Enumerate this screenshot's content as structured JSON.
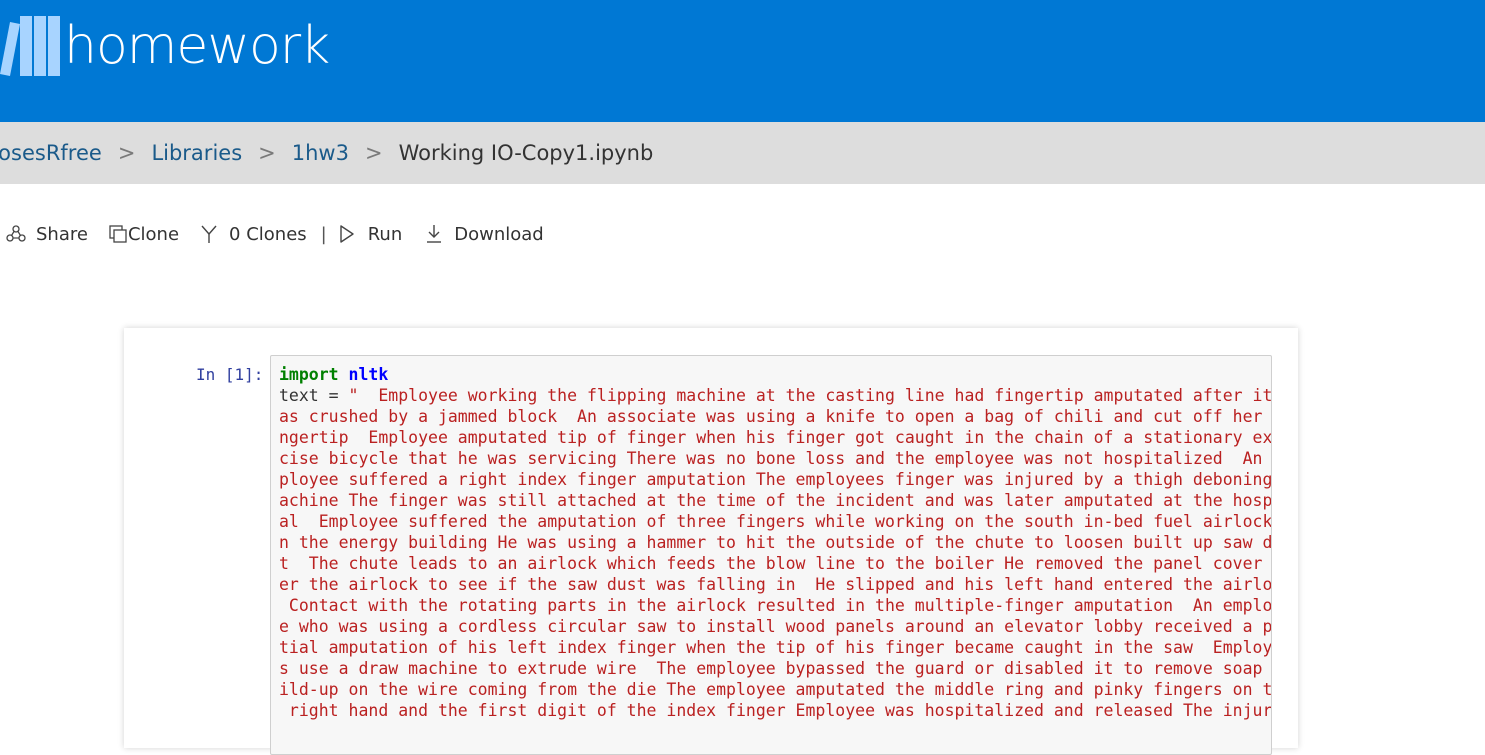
{
  "colors": {
    "brand": "#0078d4",
    "breadcrumb_bg": "#dddddd",
    "link": "#1a5a8a",
    "keyword": "#008000",
    "module": "#0000ff",
    "string": "#ba2121",
    "prompt": "#303f9f"
  },
  "header": {
    "logo_icon": "books-icon",
    "logo_text": "homework"
  },
  "breadcrumb": {
    "items": [
      "rosesRfree",
      "Libraries",
      "1hw3"
    ],
    "separator": ">",
    "current": "Working IO-Copy1.ipynb"
  },
  "toolbar": {
    "share": {
      "icon": "share-icon",
      "label": "Share"
    },
    "clone": {
      "icon": "clone-icon",
      "label": "Clone"
    },
    "clones": {
      "icon": "fork-icon",
      "label": "0 Clones"
    },
    "separator": "|",
    "run": {
      "icon": "play-icon",
      "label": "Run"
    },
    "download": {
      "icon": "download-icon",
      "label": "Download"
    }
  },
  "cell": {
    "prompt": "In [1]:",
    "kw_import": "import",
    "module": "nltk",
    "var_assign": "text = ",
    "string_lines": [
      "\"  Employee working the flipping machine at the casting line had fingertip amputated after it w",
      "as crushed by a jammed block  An associate was using a knife to open a bag of chili and cut off her fi",
      "ngertip  Employee amputated tip of finger when his finger got caught in the chain of a stationary exer",
      "cise bicycle that he was servicing There was no bone loss and the employee was not hospitalized  An em",
      "ployee suffered a right index finger amputation The employees finger was injured by a thigh deboning m",
      "achine The finger was still attached at the time of the incident and was later amputated at the hospit",
      "al  Employee suffered the amputation of three fingers while working on the south in-bed fuel airlock i",
      "n the energy building He was using a hammer to hit the outside of the chute to loosen built up saw dus",
      "t  The chute leads to an airlock which feeds the blow line to the boiler He removed the panel cover ov",
      "er the airlock to see if the saw dust was falling in  He slipped and his left hand entered the airlock",
      " Contact with the rotating parts in the airlock resulted in the multiple-finger amputation  An employe",
      "e who was using a cordless circular saw to install wood panels around an elevator lobby received a par",
      "tial amputation of his left index finger when the tip of his finger became caught in the saw  Employee",
      "s use a draw machine to extrude wire  The employee bypassed the guard or disabled it to remove soap bu",
      "ild-up on the wire coming from the die The employee amputated the middle ring and pinky fingers on the",
      " right hand and the first digit of the index finger Employee was hospitalized and released The injury"
    ]
  }
}
